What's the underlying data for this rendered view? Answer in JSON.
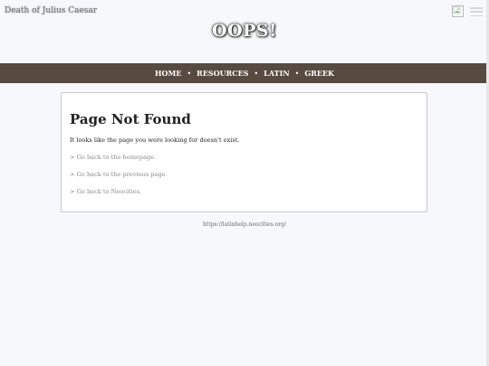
{
  "header": {
    "site_title": "Death of Julius Caesar",
    "banner_text": "OOPS!"
  },
  "nav": {
    "items": [
      {
        "label": "HOME"
      },
      {
        "label": "RESOURCES"
      },
      {
        "label": "LATIN"
      },
      {
        "label": "GREEK"
      }
    ],
    "separator": "•"
  },
  "content": {
    "title": "Page Not Found",
    "message": "It looks like the page you were looking for doesn't exist.",
    "links": [
      {
        "label": "> Go back to the homepage."
      },
      {
        "label": "> Go back to the previous page."
      },
      {
        "label": "> Go back to Neocities."
      }
    ]
  },
  "footer": {
    "url": "https://latinhelp.neocities.org/"
  },
  "colors": {
    "background": "#f7f8fb",
    "nav_background": "#574a40",
    "card_background": "#ffffff",
    "link_color": "#8a8a8a"
  },
  "icons": {
    "broken_image": "broken-image-icon",
    "menu": "hamburger-menu-icon"
  }
}
